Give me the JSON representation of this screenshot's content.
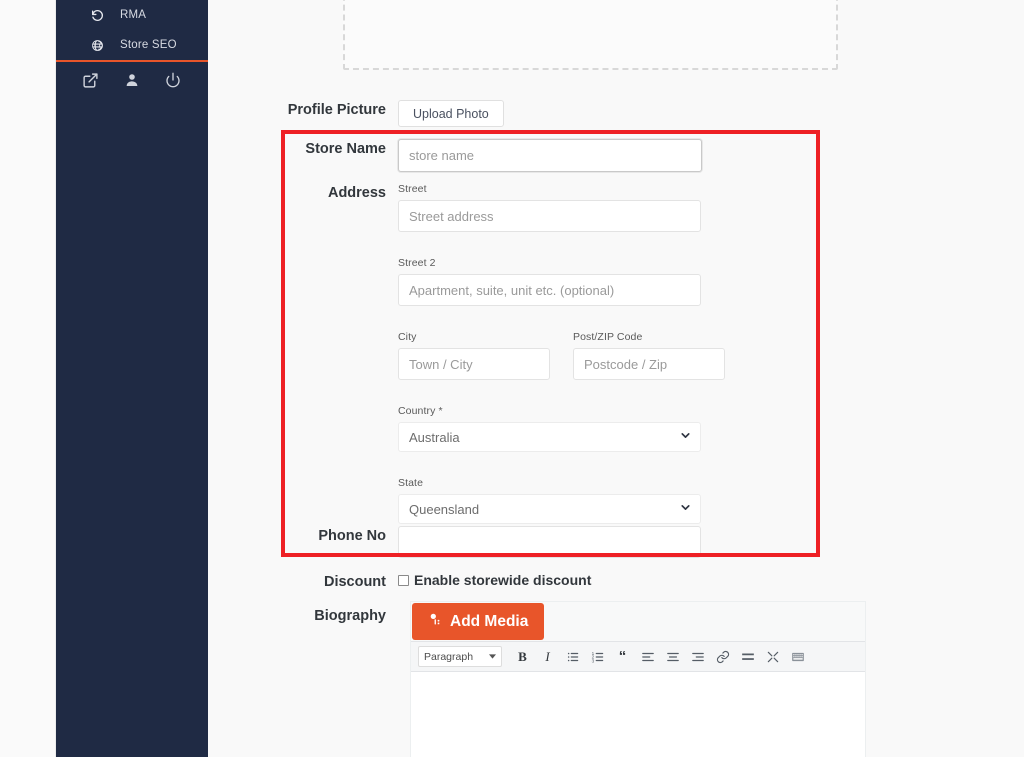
{
  "sidebar": {
    "items": [
      {
        "label": "RMA",
        "icon": "undo-icon"
      },
      {
        "label": "Store SEO",
        "icon": "globe-icon"
      }
    ],
    "actions": [
      {
        "name": "visit-store-icon",
        "label": "Visit Store"
      },
      {
        "name": "account-icon",
        "label": "Account"
      },
      {
        "name": "logout-icon",
        "label": "Logout"
      }
    ],
    "accent_color": "#e8552a",
    "background_color": "#1f2a44"
  },
  "form": {
    "profile_picture": {
      "label": "Profile Picture",
      "upload_button": "Upload Photo"
    },
    "store_name": {
      "label": "Store Name",
      "placeholder": "store name",
      "value": ""
    },
    "address": {
      "label": "Address",
      "street": {
        "label": "Street",
        "placeholder": "Street address",
        "value": ""
      },
      "street2": {
        "label": "Street 2",
        "placeholder": "Apartment, suite, unit etc. (optional)",
        "value": ""
      },
      "city": {
        "label": "City",
        "placeholder": "Town / City",
        "value": ""
      },
      "postcode": {
        "label": "Post/ZIP Code",
        "placeholder": "Postcode / Zip",
        "value": ""
      },
      "country": {
        "label": "Country *",
        "selected": "Australia"
      },
      "state": {
        "label": "State",
        "selected": "Queensland"
      }
    },
    "phone": {
      "label": "Phone No",
      "placeholder": "",
      "value": ""
    },
    "discount": {
      "label": "Discount",
      "checkbox_label": "Enable storewide discount",
      "checked": false
    },
    "biography": {
      "label": "Biography",
      "add_media_button": "Add Media",
      "format_select": "Paragraph",
      "toolbar": [
        {
          "name": "bold-icon",
          "glyph": "B"
        },
        {
          "name": "italic-icon",
          "glyph": "I"
        },
        {
          "name": "bulleted-list-icon",
          "glyph": "list-ul"
        },
        {
          "name": "numbered-list-icon",
          "glyph": "list-ol"
        },
        {
          "name": "blockquote-icon",
          "glyph": "“"
        },
        {
          "name": "align-left-icon",
          "glyph": "align-left"
        },
        {
          "name": "align-center-icon",
          "glyph": "align-center"
        },
        {
          "name": "align-right-icon",
          "glyph": "align-right"
        },
        {
          "name": "insert-link-icon",
          "glyph": "link"
        },
        {
          "name": "read-more-icon",
          "glyph": "more"
        },
        {
          "name": "fullscreen-icon",
          "glyph": "fullscreen"
        },
        {
          "name": "toolbar-toggle-icon",
          "glyph": "kitchen-sink"
        }
      ],
      "content": ""
    }
  },
  "highlight": {
    "color": "#ee2025"
  }
}
